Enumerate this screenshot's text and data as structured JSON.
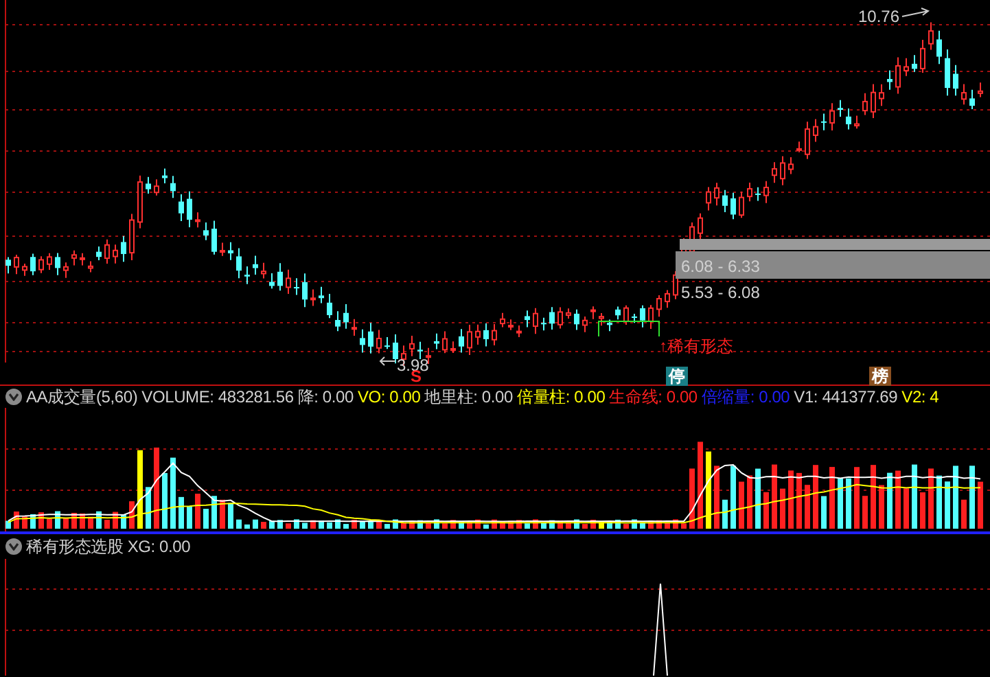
{
  "price_panel": {
    "high_label": "10.76",
    "low_label": "3.98",
    "zones": [
      {
        "text": "6.08 - 6.33",
        "highlighted": true
      },
      {
        "text": "5.53 - 6.08",
        "highlighted": false
      }
    ],
    "pattern_label": "↑稀有形态",
    "markers": [
      {
        "text": "S",
        "kind": "sell"
      },
      {
        "text": "停",
        "kind": "halt"
      },
      {
        "text": "榜",
        "kind": "list"
      }
    ]
  },
  "volume_panel": {
    "title": "AA成交量(5,60)",
    "fields": [
      {
        "text": "VOLUME: 483281.56",
        "color": "#d0d0d0"
      },
      {
        "text": "降: 0.00",
        "color": "#d0d0d0"
      },
      {
        "text": "VO: 0.00",
        "color": "#ffff00"
      },
      {
        "text": "地里柱: 0.00",
        "color": "#d0d0d0"
      },
      {
        "text": "倍量柱: 0.00",
        "color": "#ffff00"
      },
      {
        "text": "生命线: 0.00",
        "color": "#ff2020"
      },
      {
        "text": "倍缩量: 0.00",
        "color": "#2020ff"
      },
      {
        "text": "V1: 441377.69",
        "color": "#d0d0d0"
      },
      {
        "text": "V2: 4",
        "color": "#ffff00"
      }
    ]
  },
  "signal_panel": {
    "title": "稀有形态选股",
    "fields": [
      {
        "text": "XG: 0.00",
        "color": "#d0d0d0"
      }
    ]
  }
}
